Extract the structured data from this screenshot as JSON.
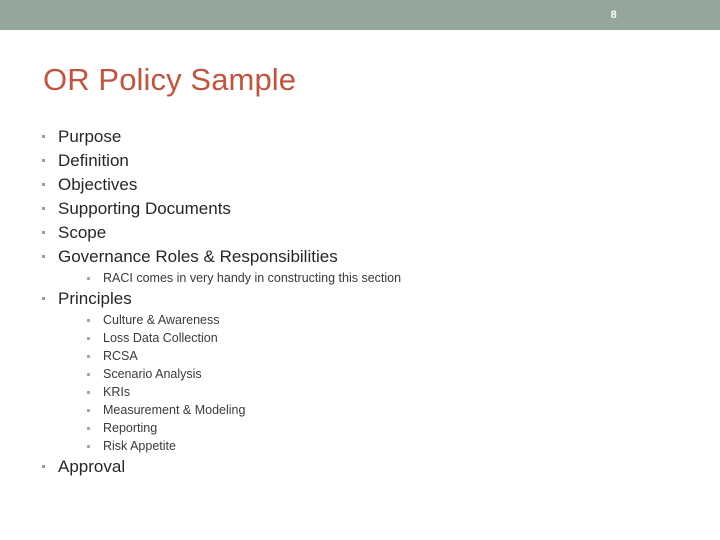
{
  "slide": {
    "page_number": "8",
    "title": "OR Policy Sample",
    "title_color": "#c0543f",
    "banner_color": "#95a69b",
    "body_text_color": "#262626",
    "bullet_color": "#9b9b9b",
    "outline": [
      {
        "level": 1,
        "text": "Purpose"
      },
      {
        "level": 1,
        "text": "Definition"
      },
      {
        "level": 1,
        "text": "Objectives"
      },
      {
        "level": 1,
        "text": "Supporting Documents"
      },
      {
        "level": 1,
        "text": "Scope"
      },
      {
        "level": 1,
        "text": "Governance Roles & Responsibilities"
      },
      {
        "level": 2,
        "text": "RACI comes in very handy in constructing this section"
      },
      {
        "level": 1,
        "text": "Principles"
      },
      {
        "level": 2,
        "text": "Culture & Awareness"
      },
      {
        "level": 2,
        "text": "Loss Data Collection"
      },
      {
        "level": 2,
        "text": "RCSA"
      },
      {
        "level": 2,
        "text": "Scenario Analysis"
      },
      {
        "level": 2,
        "text": "KRIs"
      },
      {
        "level": 2,
        "text": "Measurement & Modeling"
      },
      {
        "level": 2,
        "text": "Reporting"
      },
      {
        "level": 2,
        "text": "Risk Appetite"
      },
      {
        "level": 1,
        "text": "Approval"
      }
    ]
  }
}
